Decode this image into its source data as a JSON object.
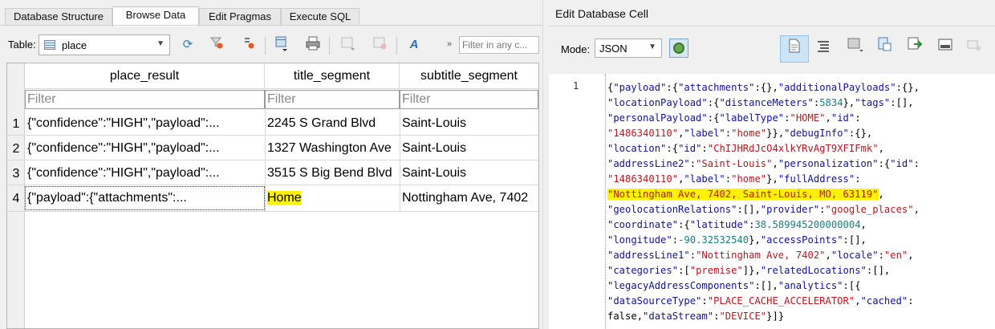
{
  "tabs": [
    "Database Structure",
    "Browse Data",
    "Edit Pragmas",
    "Execute SQL"
  ],
  "toolbar": {
    "table_label": "Table:",
    "table_value": "place",
    "filter_placeholder": "Filter in any c...",
    "overflow": "»"
  },
  "grid": {
    "columns": [
      "place_result",
      "title_segment",
      "subtitle_segment"
    ],
    "filter_placeholder": "Filter",
    "rows": [
      {
        "num": "1",
        "place_result": "{\"confidence\":\"HIGH\",\"payload\":...",
        "title_segment": "2245 S Grand Blvd",
        "subtitle_segment": "Saint-Louis"
      },
      {
        "num": "2",
        "place_result": "{\"confidence\":\"HIGH\",\"payload\":...",
        "title_segment": "1327 Washington Ave",
        "subtitle_segment": "Saint-Louis"
      },
      {
        "num": "3",
        "place_result": "{\"confidence\":\"HIGH\",\"payload\":...",
        "title_segment": "3515 S Big Bend Blvd",
        "subtitle_segment": "Saint-Louis"
      },
      {
        "num": "4",
        "place_result": "{\"payload\":{\"attachments\":...",
        "title_segment": "Home",
        "subtitle_segment": "Nottingham Ave, 7402"
      }
    ]
  },
  "editor_panel": {
    "title": "Edit Database Cell",
    "mode_label": "Mode:",
    "mode_value": "JSON",
    "line_number": "1",
    "code_lines": [
      "{\"payload\":{\"attachments\":{},\"additionalPayloads\":{},",
      "\"locationPayload\":{\"distanceMeters\":5834},\"tags\":[],",
      "\"personalPayload\":{\"labelType\":\"HOME\",\"id\":",
      "\"1486340110\",\"label\":\"home\"}},\"debugInfo\":{},",
      "\"location\":{\"id\":\"ChIJHRdJcO4xlkYRvAgT9XFIFmk\",",
      "\"addressLine2\":\"Saint-Louis\",\"personalization\":{\"id\":",
      "\"1486340110\",\"label\":\"home\"},\"fullAddress\":",
      "\"Nottingham Ave, 7402, Saint-Louis, MO, 63119\",",
      "\"geolocationRelations\":[],\"provider\":\"google_places\",",
      "\"coordinate\":{\"latitude\":38.589945200000004,",
      "\"longitude\":-90.32532540},\"accessPoints\":[],",
      "\"addressLine1\":\"Nottingham Ave, 7402\",\"locale\":\"en\",",
      "\"categories\":[\"premise\"]},\"relatedLocations\":[],",
      "\"legacyAddressComponents\":[],\"analytics\":[{",
      "\"dataSourceType\":\"PLACE_CACHE_ACCELERATOR\",\"cached\":",
      "false,\"dataStream\":\"DEVICE\"}]}"
    ]
  },
  "colors": {
    "json_key": "#1010a0",
    "json_string": "#c0151f",
    "json_number": "#128484",
    "highlight": "#fff200"
  }
}
